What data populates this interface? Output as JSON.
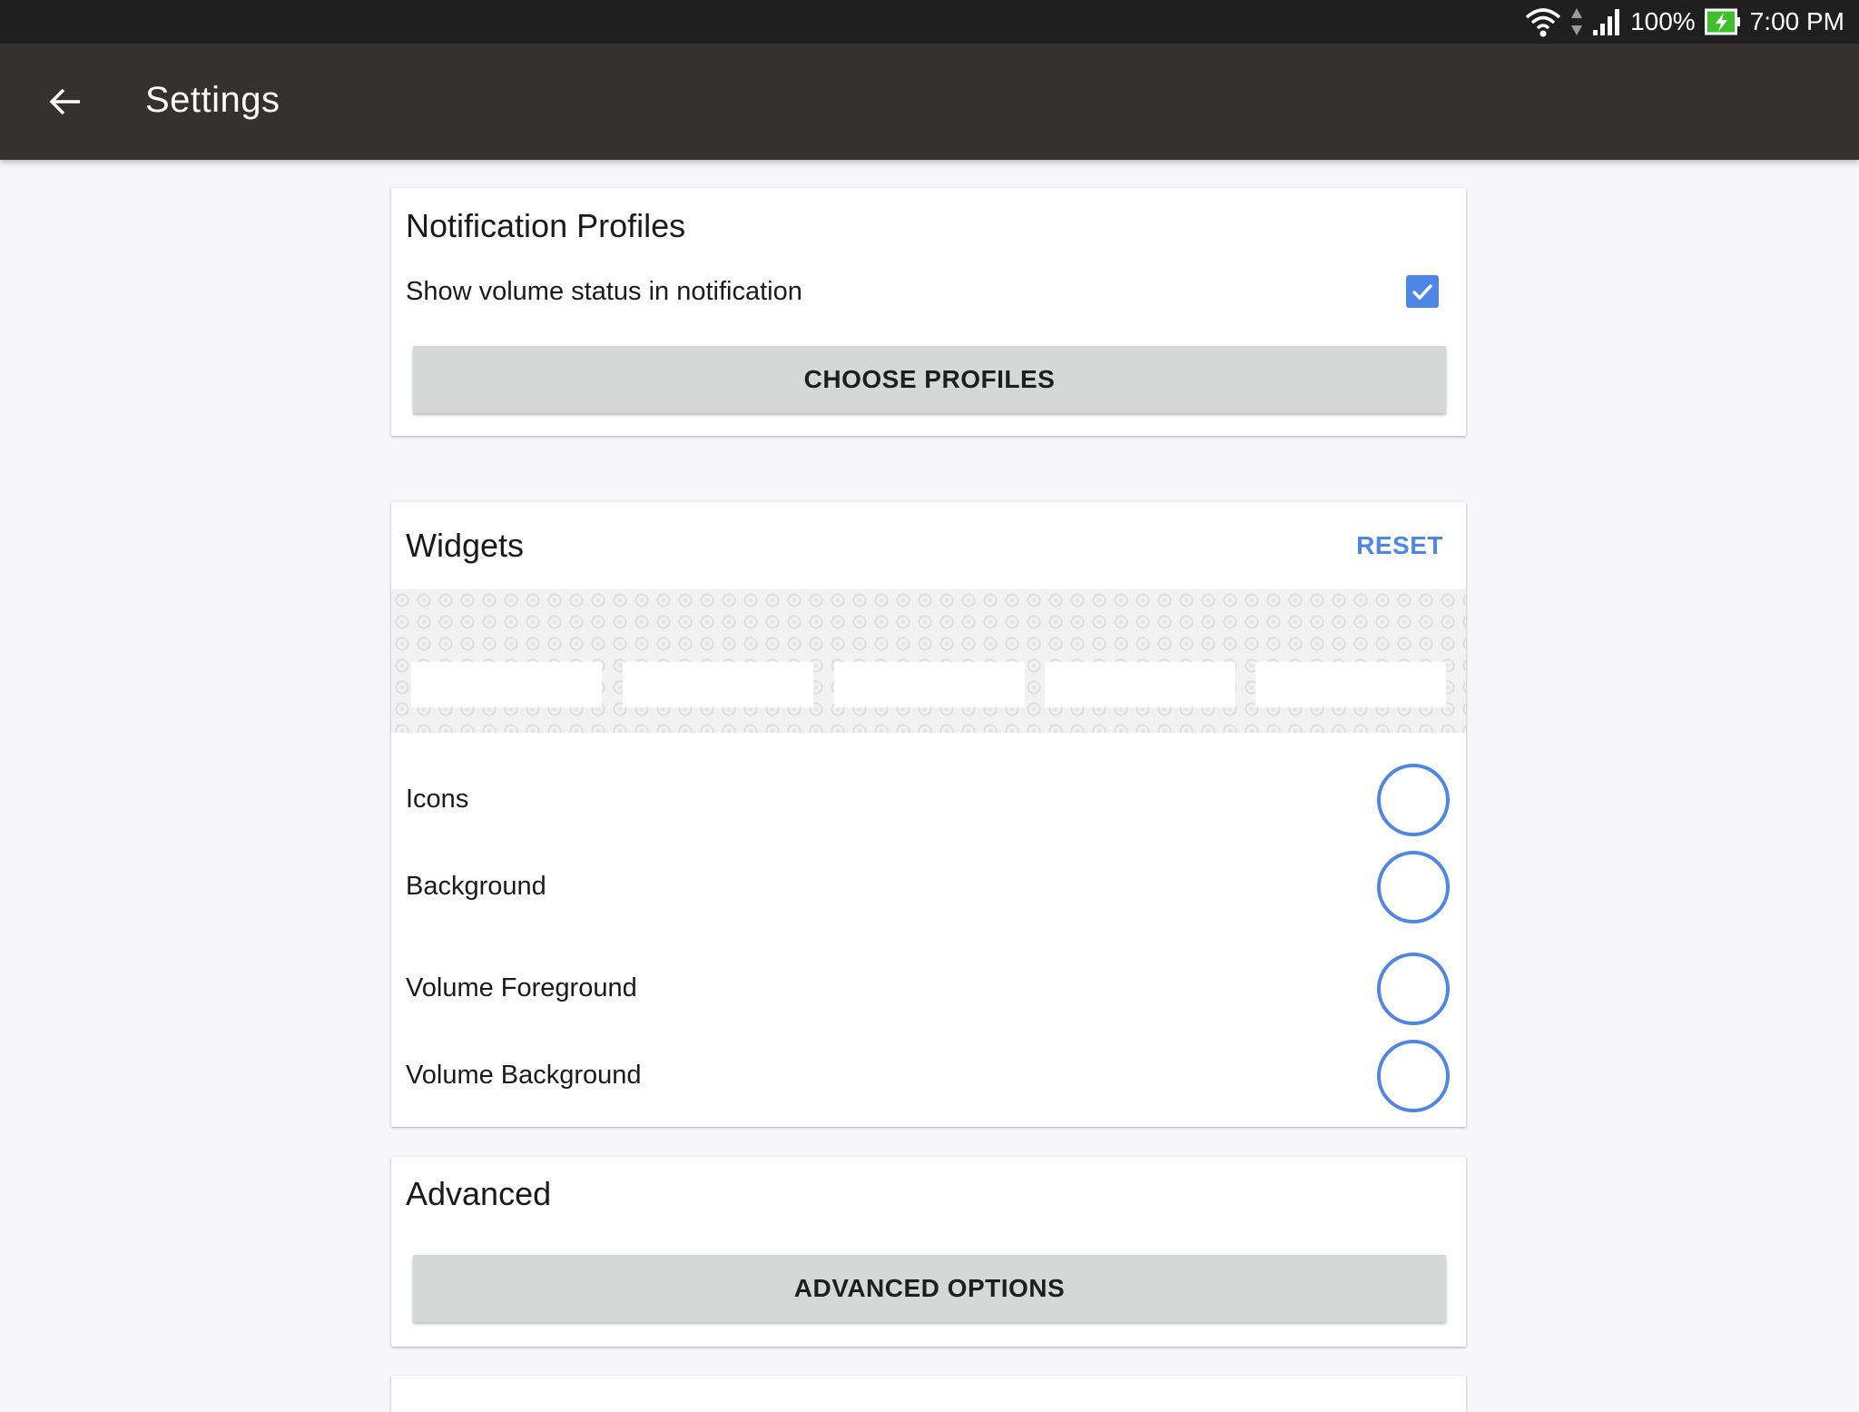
{
  "colors": {
    "accent": "#4e86e6",
    "app_bar": "#33322e",
    "status_bar": "#1f1f1f",
    "button_bg": "#d6d7d7",
    "battery_fill": "#3ec02c"
  },
  "status_bar": {
    "icons": [
      "wifi-icon",
      "data-arrows-icon",
      "cell-signal-icon",
      "battery-charging-icon"
    ],
    "battery_percent": "100%",
    "time": "7:00 PM"
  },
  "app_bar": {
    "back_icon": "arrow-back-icon",
    "title": "Settings"
  },
  "notification_profiles": {
    "title": "Notification Profiles",
    "show_volume_label": "Show volume status in notification",
    "show_volume_checked": true,
    "choose_profiles_button": "CHOOSE PROFILES"
  },
  "widgets": {
    "title": "Widgets",
    "reset_label": "RESET",
    "preview_slot_count": 5,
    "color_rows": [
      {
        "label": "Icons"
      },
      {
        "label": "Background"
      },
      {
        "label": "Volume Foreground"
      },
      {
        "label": "Volume Background"
      }
    ]
  },
  "advanced": {
    "title": "Advanced",
    "options_button": "ADVANCED OPTIONS"
  }
}
